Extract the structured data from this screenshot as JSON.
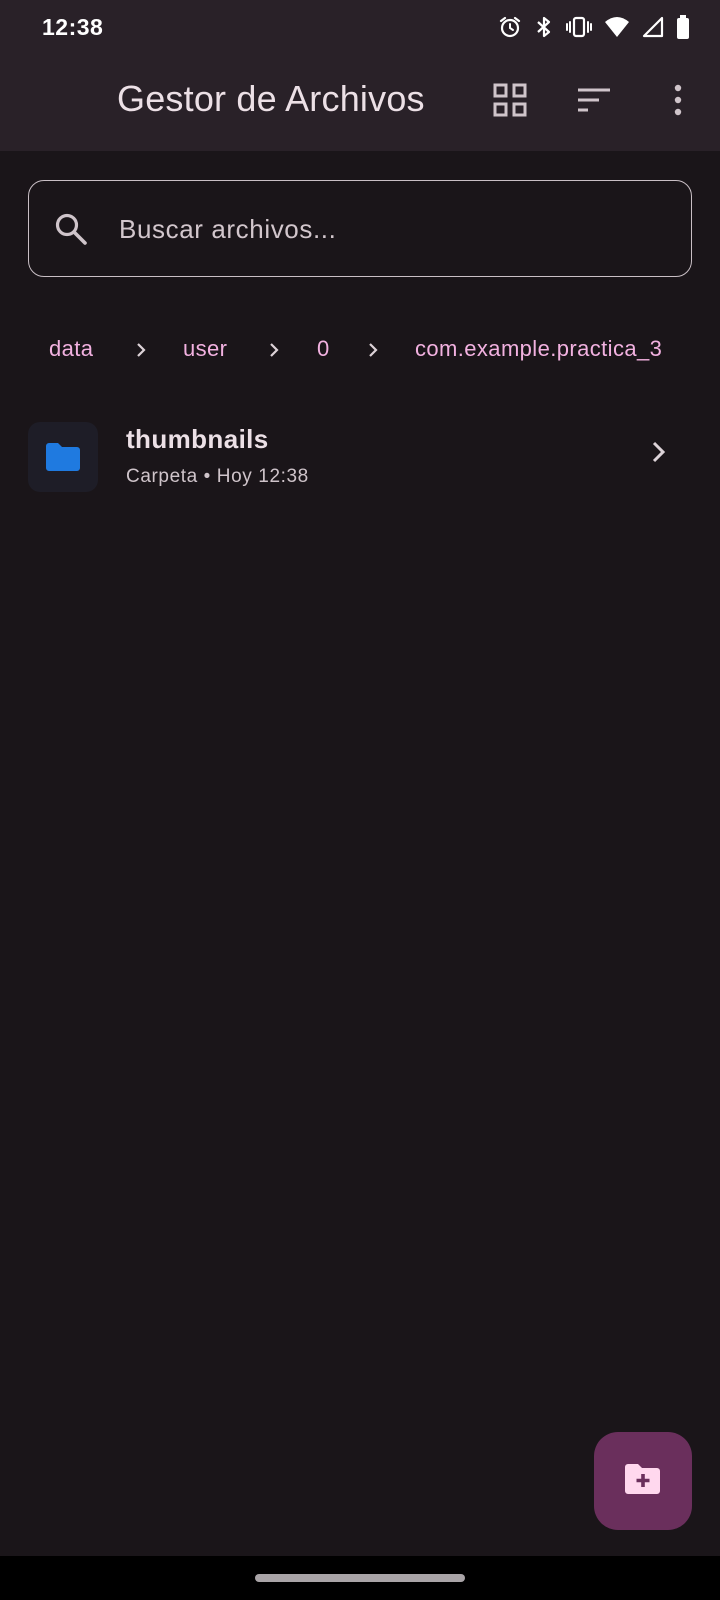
{
  "status_bar": {
    "time": "12:38",
    "icons": [
      "alarm-icon",
      "bluetooth-icon",
      "vibrate-icon",
      "wifi-icon",
      "signal-icon",
      "battery-icon"
    ]
  },
  "app_bar": {
    "title": "Gestor de Archivos",
    "actions": [
      "grid-view-icon",
      "sort-icon",
      "more-vert-icon"
    ]
  },
  "search": {
    "placeholder": "Buscar archivos...",
    "value": ""
  },
  "breadcrumb": {
    "items": [
      "data",
      "user",
      "0",
      "com.example.practica_3"
    ]
  },
  "files": [
    {
      "name": "thumbnails",
      "meta": "Carpeta • Hoy 12:38",
      "icon": "folder-icon"
    }
  ],
  "fab": {
    "icon": "create-new-folder-icon"
  },
  "colors": {
    "background": "#1a1519",
    "app_bar": "#292128",
    "accent_pink": "#f2b1e0",
    "fab": "#6a2f5c",
    "folder_blue": "#1f7ae0"
  }
}
